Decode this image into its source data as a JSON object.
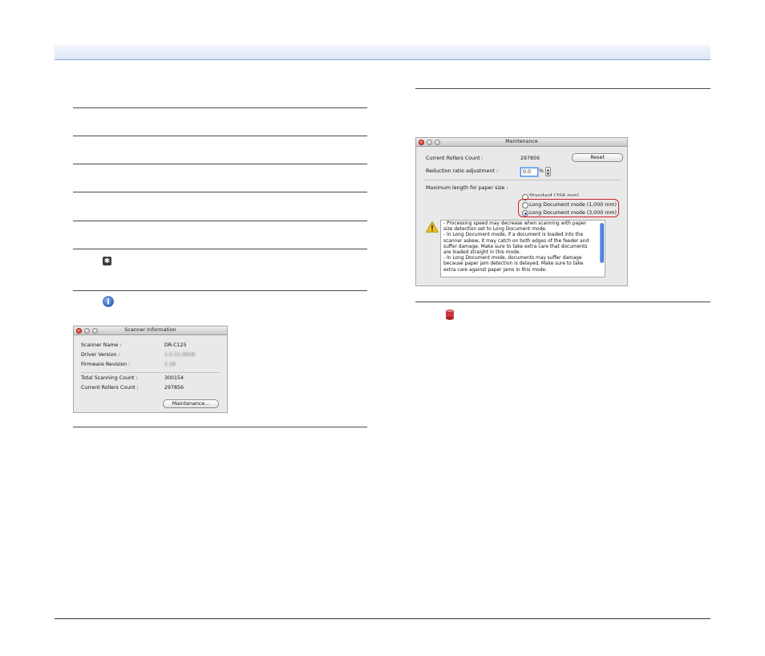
{
  "page": {
    "accent_color": "#8ea7cf"
  },
  "scanner_info_window": {
    "title": "Scanner Information",
    "rows": [
      {
        "label": "Scanner Name :",
        "value": "DR-C125",
        "blurred": false
      },
      {
        "label": "Driver Version :",
        "value": "1.0.11.0918",
        "blurred": true
      },
      {
        "label": "Firmware Revision :",
        "value": "1.16",
        "blurred": true
      },
      {
        "label": "Total Scanning Count :",
        "value": "300154",
        "blurred": false
      },
      {
        "label": "Current Rollers Count :",
        "value": "297856",
        "blurred": false
      }
    ],
    "maintenance_button": "Maintenance..."
  },
  "maintenance_window": {
    "title": "Maintenance",
    "rollers_label": "Current Rollers Count :",
    "rollers_value": "297856",
    "reset_button": "Reset",
    "reduction_label": "Reduction ratio adjustment :",
    "reduction_value": "0.0",
    "reduction_unit": "%",
    "max_length_label": "Maximum length for paper size :",
    "options": [
      {
        "label": "Standard (356 mm)",
        "selected": false
      },
      {
        "label": "Long Document mode (1,000 mm)",
        "selected": false
      },
      {
        "label": "Long Document mode (3,000 mm)",
        "selected": true
      }
    ],
    "note_lines": [
      "- Processing speed may decrease when scanning with paper",
      "size detection set to Long Document mode.",
      "- In Long Document mode, if a document is loaded into the",
      "scanner askew, it may catch on both edges of the feeder and",
      "suffer damage. Make sure to take extra care that documents",
      "are loaded straight in this mode.",
      "- In Long Document mode, documents may suffer damage",
      "because paper jam detection is delayed. Make sure to take",
      "extra care against paper jams in this mode."
    ],
    "highlight_color": "#d0202a"
  }
}
